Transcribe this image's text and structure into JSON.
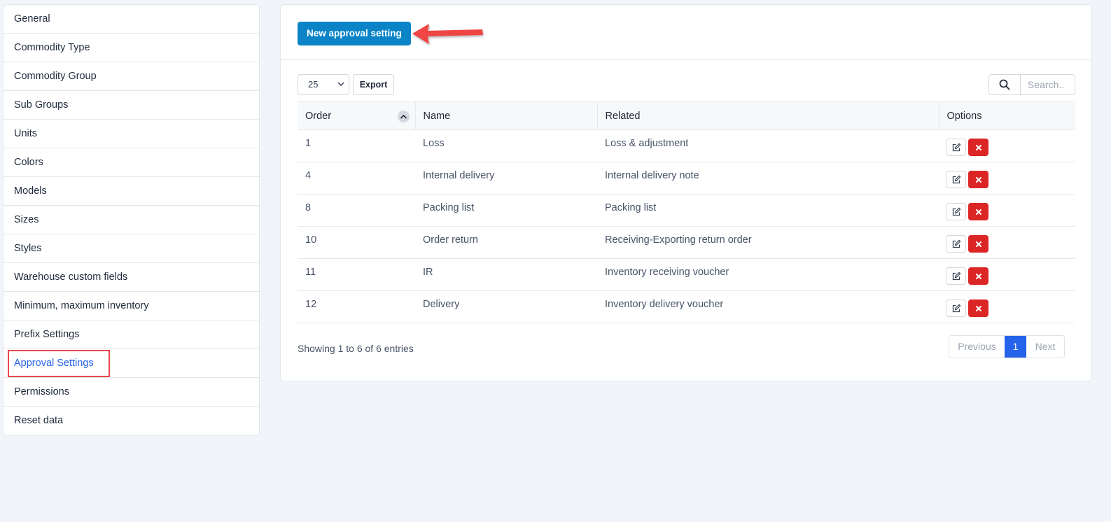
{
  "sidebar": {
    "items": [
      {
        "label": "General"
      },
      {
        "label": "Commodity Type"
      },
      {
        "label": "Commodity Group"
      },
      {
        "label": "Sub Groups"
      },
      {
        "label": "Units"
      },
      {
        "label": "Colors"
      },
      {
        "label": "Models"
      },
      {
        "label": "Sizes"
      },
      {
        "label": "Styles"
      },
      {
        "label": "Warehouse custom fields"
      },
      {
        "label": "Minimum, maximum inventory"
      },
      {
        "label": "Prefix Settings"
      },
      {
        "label": "Approval Settings"
      },
      {
        "label": "Permissions"
      },
      {
        "label": "Reset data"
      }
    ],
    "active": "Approval Settings"
  },
  "header": {
    "new_button": "New approval setting"
  },
  "toolbar": {
    "page_length": "25",
    "export_label": "Export",
    "search_placeholder": "Search.."
  },
  "table": {
    "columns": [
      "Order",
      "Name",
      "Related",
      "Options"
    ],
    "rows": [
      {
        "order": "1",
        "name": "Loss",
        "related": "Loss & adjustment"
      },
      {
        "order": "4",
        "name": "Internal delivery",
        "related": "Internal delivery note"
      },
      {
        "order": "8",
        "name": "Packing list",
        "related": "Packing list"
      },
      {
        "order": "10",
        "name": "Order return",
        "related": "Receiving-Exporting return order"
      },
      {
        "order": "11",
        "name": "IR",
        "related": "Inventory receiving voucher"
      },
      {
        "order": "12",
        "name": "Delivery",
        "related": "Inventory delivery voucher"
      }
    ]
  },
  "footer": {
    "info": "Showing 1 to 6 of 6 entries",
    "previous": "Previous",
    "page": "1",
    "next": "Next"
  },
  "colors": {
    "primary_button": "#0a84c6",
    "active_page": "#2563eb",
    "delete_button": "#dc2626",
    "highlight": "#e5484d"
  }
}
